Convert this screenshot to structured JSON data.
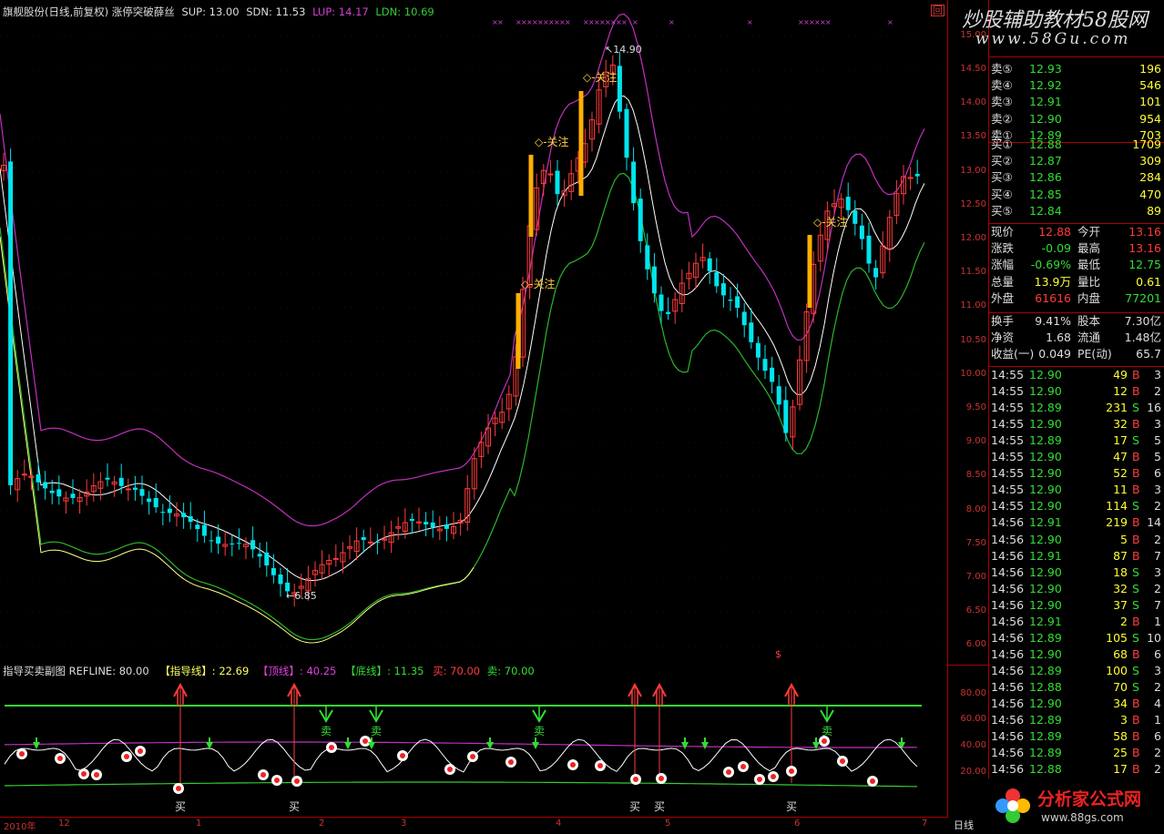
{
  "header": {
    "title": "旗舰股份(日线,前复权) 涨停突破薛丝",
    "sup_label": "SUP: 13.00",
    "sdn_label": "SDN: 11.53",
    "lup_label": "LUP: 14.17",
    "ldn_label": "LDN: 10.69",
    "close_marker": "回"
  },
  "sub_header": {
    "title": "指导买卖副图 REFLINE: 80.00",
    "guide": "【指导线】: 22.69",
    "top": "【顶线】: 40.25",
    "bottom": "【底线】: 11.35",
    "buy": "买: 70.00",
    "sell": "卖: 70.00"
  },
  "annotations": {
    "high_label": "14.90",
    "low_label": "←6.85",
    "attention": "关注",
    "buy": "买",
    "sell": "卖",
    "dollar": "$"
  },
  "colors": {
    "up": "#ff3b3b",
    "down": "#00e5ee",
    "upper_band": "#c030c0",
    "middle": "#ffffff",
    "lower": "#2bb62b",
    "yellow_line": "#ffff80",
    "highlight": "#ffb000"
  },
  "price_axis": [
    "15.00",
    "14.50",
    "14.00",
    "13.50",
    "13.00",
    "12.50",
    "12.00",
    "11.50",
    "11.00",
    "10.50",
    "10.00",
    "9.50",
    "9.00",
    "8.50",
    "8.00",
    "7.50",
    "7.00",
    "6.50",
    "6.00"
  ],
  "sub_axis": [
    "80.00",
    "60.00",
    "40.00",
    "20.00"
  ],
  "date_axis": [
    "2010年",
    "12",
    "1",
    "2",
    "3",
    "4",
    "5",
    "6",
    "7"
  ],
  "watermark": {
    "line1": "炒股辅助教材58股网",
    "line2": "www.58Gu.com",
    "logo2": "分析家公式网",
    "logo2_url": "www.88gs.com"
  },
  "footer": {
    "day": "日线"
  },
  "order_book": {
    "asks": [
      {
        "label": "卖⑤",
        "price": "12.93",
        "vol": "196"
      },
      {
        "label": "卖④",
        "price": "12.92",
        "vol": "546"
      },
      {
        "label": "卖③",
        "price": "12.91",
        "vol": "101"
      },
      {
        "label": "卖②",
        "price": "12.90",
        "vol": "954"
      },
      {
        "label": "卖①",
        "price": "12.89",
        "vol": "703"
      }
    ],
    "bids": [
      {
        "label": "买①",
        "price": "12.88",
        "vol": "1709"
      },
      {
        "label": "买②",
        "price": "12.87",
        "vol": "309"
      },
      {
        "label": "买③",
        "price": "12.86",
        "vol": "284"
      },
      {
        "label": "买④",
        "price": "12.85",
        "vol": "470"
      },
      {
        "label": "买⑤",
        "price": "12.84",
        "vol": "89"
      }
    ]
  },
  "quote": [
    {
      "l1": "现价",
      "v1": "12.88",
      "l2": "今开",
      "v2": "13.16",
      "c1": "#ff3b3b",
      "c2": "#ff3b3b"
    },
    {
      "l1": "涨跌",
      "v1": "-0.09",
      "l2": "最高",
      "v2": "13.16",
      "c1": "#33dd33",
      "c2": "#ff3b3b"
    },
    {
      "l1": "涨幅",
      "v1": "-0.69%",
      "l2": "最低",
      "v2": "12.75",
      "c1": "#33dd33",
      "c2": "#33dd33"
    },
    {
      "l1": "总量",
      "v1": "13.9万",
      "l2": "量比",
      "v2": "0.61",
      "c1": "#ffff33",
      "c2": "#ffff33"
    },
    {
      "l1": "外盘",
      "v1": "61616",
      "l2": "内盘",
      "v2": "77201",
      "c1": "#ff3b3b",
      "c2": "#33dd33"
    }
  ],
  "stats": [
    {
      "l1": "换手",
      "v1": "9.41%",
      "l2": "股本",
      "v2": "7.30亿"
    },
    {
      "l1": "净资",
      "v1": "1.68",
      "l2": "流通",
      "v2": "1.48亿"
    },
    {
      "l1": "收益(一)",
      "v1": "0.049",
      "l2": "PE(动)",
      "v2": "65.7"
    }
  ],
  "ticks": [
    {
      "t": "14:55",
      "p": "12.90",
      "v": "49",
      "s": "B",
      "n": "3"
    },
    {
      "t": "14:55",
      "p": "12.90",
      "v": "12",
      "s": "B",
      "n": "2"
    },
    {
      "t": "14:55",
      "p": "12.89",
      "v": "231",
      "s": "S",
      "n": "16"
    },
    {
      "t": "14:55",
      "p": "12.90",
      "v": "32",
      "s": "B",
      "n": "3"
    },
    {
      "t": "14:55",
      "p": "12.89",
      "v": "17",
      "s": "S",
      "n": "5"
    },
    {
      "t": "14:55",
      "p": "12.90",
      "v": "47",
      "s": "B",
      "n": "5"
    },
    {
      "t": "14:55",
      "p": "12.90",
      "v": "52",
      "s": "B",
      "n": "6"
    },
    {
      "t": "14:55",
      "p": "12.90",
      "v": "11",
      "s": "B",
      "n": "3"
    },
    {
      "t": "14:55",
      "p": "12.90",
      "v": "114",
      "s": "S",
      "n": "2"
    },
    {
      "t": "14:56",
      "p": "12.91",
      "v": "219",
      "s": "B",
      "n": "14"
    },
    {
      "t": "14:56",
      "p": "12.90",
      "v": "5",
      "s": "B",
      "n": "2"
    },
    {
      "t": "14:56",
      "p": "12.91",
      "v": "87",
      "s": "B",
      "n": "7"
    },
    {
      "t": "14:56",
      "p": "12.90",
      "v": "18",
      "s": "S",
      "n": "3"
    },
    {
      "t": "14:56",
      "p": "12.90",
      "v": "32",
      "s": "S",
      "n": "2"
    },
    {
      "t": "14:56",
      "p": "12.90",
      "v": "37",
      "s": "S",
      "n": "7"
    },
    {
      "t": "14:56",
      "p": "12.91",
      "v": "2",
      "s": "B",
      "n": "1"
    },
    {
      "t": "14:56",
      "p": "12.89",
      "v": "105",
      "s": "S",
      "n": "10"
    },
    {
      "t": "14:56",
      "p": "12.90",
      "v": "68",
      "s": "B",
      "n": "6"
    },
    {
      "t": "14:56",
      "p": "12.89",
      "v": "100",
      "s": "S",
      "n": "3"
    },
    {
      "t": "14:56",
      "p": "12.88",
      "v": "70",
      "s": "S",
      "n": "2"
    },
    {
      "t": "14:56",
      "p": "12.90",
      "v": "34",
      "s": "B",
      "n": "4"
    },
    {
      "t": "14:56",
      "p": "12.89",
      "v": "3",
      "s": "B",
      "n": "1"
    },
    {
      "t": "14:56",
      "p": "12.89",
      "v": "58",
      "s": "B",
      "n": "6"
    },
    {
      "t": "14:56",
      "p": "12.89",
      "v": "25",
      "s": "B",
      "n": "2"
    },
    {
      "t": "14:56",
      "p": "12.88",
      "v": "17",
      "s": "B",
      "n": "2"
    }
  ]
}
